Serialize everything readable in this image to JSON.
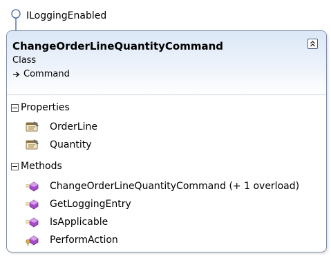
{
  "interface": {
    "name": "ILoggingEnabled"
  },
  "class_box": {
    "title": "ChangeOrderLineQuantityCommand",
    "stereotype": "Class",
    "base_class": "Command",
    "sections": [
      {
        "label": "Properties",
        "items": [
          {
            "label": "OrderLine",
            "icon": "property-icon"
          },
          {
            "label": "Quantity",
            "icon": "property-icon"
          }
        ]
      },
      {
        "label": "Methods",
        "items": [
          {
            "label": "ChangeOrderLineQuantityCommand (+ 1 overload)",
            "icon": "public-method-icon"
          },
          {
            "label": "GetLoggingEntry",
            "icon": "public-method-icon"
          },
          {
            "label": "IsApplicable",
            "icon": "public-method-icon"
          },
          {
            "label": "PerformAction",
            "icon": "protected-method-icon"
          }
        ]
      }
    ]
  },
  "colors": {
    "border": "#7f8ea6",
    "header_gradient_top": "#dbe7f7",
    "method_purple": "#a64cc8",
    "property_brown": "#8a7040",
    "lollipop_blue": "#3d5fa8"
  }
}
